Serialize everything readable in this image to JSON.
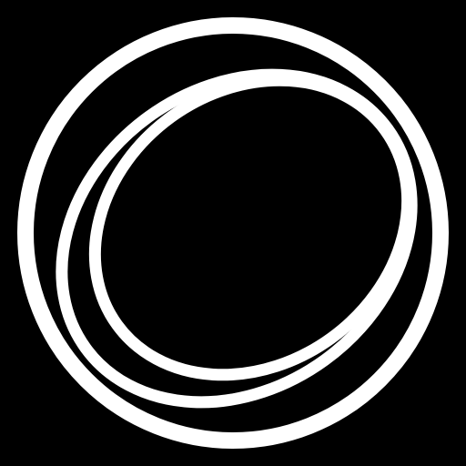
{
  "icon": {
    "name": "orbit-rings-icon",
    "background_color": "#000000",
    "foreground_color": "#ffffff"
  }
}
